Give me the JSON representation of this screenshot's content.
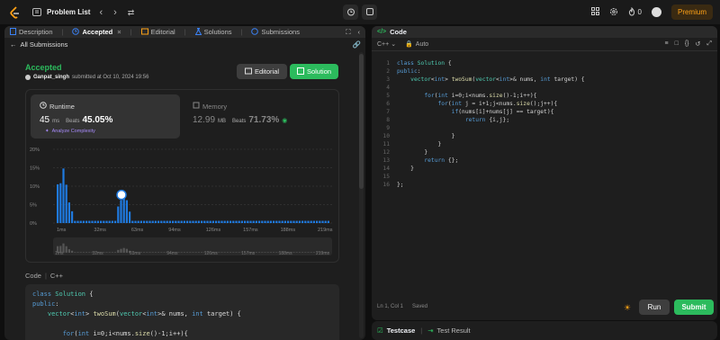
{
  "topbar": {
    "problem_list_label": "Problem List",
    "coins": "0",
    "premium_label": "Premium"
  },
  "left_tabs": [
    {
      "label": "Description",
      "icon": "description-icon"
    },
    {
      "label": "Accepted",
      "icon": "clock-icon"
    },
    {
      "label": "Editorial",
      "icon": "book-icon"
    },
    {
      "label": "Solutions",
      "icon": "flask-icon"
    },
    {
      "label": "Submissions",
      "icon": "history-icon"
    }
  ],
  "submission": {
    "back_label": "All Submissions",
    "status": "Accepted",
    "user": "Ganpat_singh",
    "submitted_text": "submitted at Oct 10, 2024 19:56",
    "editorial_btn": "Editorial",
    "solution_btn": "Solution",
    "runtime_title": "Runtime",
    "runtime_value": "45",
    "runtime_unit": "ms",
    "runtime_beats_label": "Beats",
    "runtime_beats": "45.05%",
    "analyze_label": "Analyze Complexity",
    "memory_title": "Memory",
    "memory_value": "12.99",
    "memory_unit": "MB",
    "memory_beats_label": "Beats",
    "memory_beats": "71.73%",
    "code_label": "Code",
    "code_lang": "C++"
  },
  "chart_data": {
    "type": "bar",
    "y_ticks": [
      "20%",
      "15%",
      "10%",
      "5%",
      "0%"
    ],
    "ylim": [
      0,
      20
    ],
    "x_ticks": [
      "1ms",
      "32ms",
      "63ms",
      "94ms",
      "126ms",
      "157ms",
      "188ms",
      "219ms"
    ],
    "values": [
      10.5,
      10.8,
      14.8,
      10.4,
      5.6,
      3.2,
      0.6,
      0.6,
      0.6,
      0.6,
      0.6,
      0.6,
      0.6,
      0.6,
      0.6,
      0.6,
      0.6,
      0.6,
      0.6,
      0.6,
      0.6,
      4.5,
      6.2,
      7.6,
      6.2,
      3.1,
      0.6,
      0.6,
      0.6,
      0.6,
      0.6,
      0.6,
      0.6,
      0.6,
      0.6,
      0.6,
      0.6,
      0.6,
      0.6,
      0.6,
      0.6,
      0.6,
      0.6,
      0.6,
      0.6,
      0.6,
      0.6,
      0.6,
      0.6,
      0.6,
      0.6,
      0.6,
      0.6,
      0.6,
      0.6,
      0.6,
      0.6,
      0.6,
      0.6,
      0.6,
      0.6,
      0.6,
      0.6,
      0.6,
      0.6,
      0.6,
      0.6,
      0.6,
      0.6,
      0.6,
      0.6,
      0.6,
      0.6,
      0.6,
      0.6,
      0.6,
      0.6,
      0.6,
      0.6,
      0.6,
      0.6,
      0.6,
      0.6,
      0.6,
      0.6,
      0.6,
      0.6,
      0.6,
      0.6,
      0.6,
      0.6,
      0.6,
      0.6,
      0.6,
      0.6
    ],
    "highlight_index": 22,
    "bar_color": "#1f7ae0",
    "mini_ticks": [
      "1ms",
      "32ms",
      "63ms",
      "94ms",
      "126ms",
      "157ms",
      "188ms",
      "219ms"
    ]
  },
  "left_code": [
    "class Solution {",
    "public:",
    "    vector<int> twoSum(vector<int>& nums, int target) {",
    "",
    "        for(int i=0;i<nums.size()-1;i++){"
  ],
  "editor": {
    "title": "Code",
    "language": "C++",
    "auto_label": "Auto",
    "lines": [
      "class Solution {",
      "public:",
      "    vector<int> twoSum(vector<int>& nums, int target) {",
      "",
      "        for(int i=0;i<nums.size()-1;i++){",
      "            for(int j = i+1;j<nums.size();j++){",
      "                if(nums[i]+nums[j] == target){",
      "                    return {i,j};",
      "",
      "                }",
      "            }",
      "        }",
      "        return {};",
      "    }",
      "",
      "};"
    ],
    "cursor_pos": "Ln 1, Col 1",
    "saved_label": "Saved",
    "run_label": "Run",
    "submit_label": "Submit"
  },
  "bottom_tabs": {
    "testcase": "Testcase",
    "test_result": "Test Result"
  }
}
